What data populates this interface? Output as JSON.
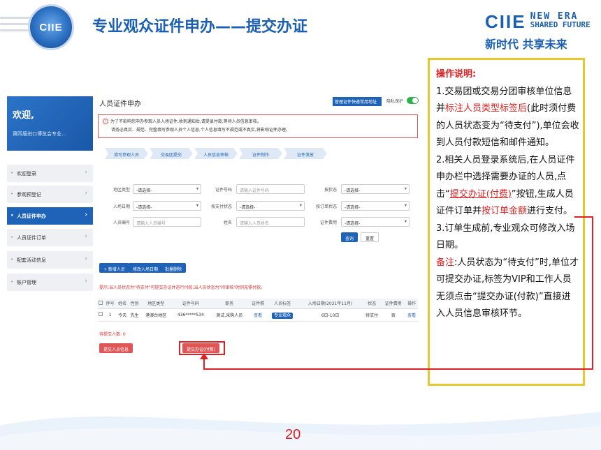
{
  "header": {
    "logo_text": "CIIE",
    "title": "专业观众证件申办——提交办证",
    "brand": "CIIE",
    "brand_line1": "NEW ERA",
    "brand_line2": "SHARED FUTURE",
    "slogan": "新时代 共享未来"
  },
  "sidebar": {
    "welcome": "欢迎,",
    "welcome_sub": "第四届进口博览会专业…",
    "items": [
      {
        "label": "欢迎登录"
      },
      {
        "label": "参观预登记"
      },
      {
        "label": "人员证件申办"
      },
      {
        "label": "人员证件订单"
      },
      {
        "label": "配套活动信息"
      },
      {
        "label": "账户管理"
      }
    ]
  },
  "main": {
    "title": "人员证件申办",
    "top_button": "管理证件快递常用地址",
    "privacy_label": "隐私保护",
    "notice_line1": "为了不影响您申办参观人员入场证件,收到通知后,请提录付款,等待人员信息审核。",
    "notice_line2": "请务必真实、规范、完整填写参观人员个人信息,个人信息填写不规范或不真实,将影响证件办理。",
    "steps": [
      "填写参观人员",
      "交易团提交",
      "人员信息审核",
      "证件制作",
      "证件发放"
    ],
    "filters": {
      "region_type": {
        "label": "地区类型",
        "value": "-请选择-"
      },
      "cert_no": {
        "label": "证件号码",
        "placeholder": "请输入证件号码"
      },
      "status": {
        "label": "按状态",
        "value": "-请选择-"
      },
      "entry_date": {
        "label": "入场日期",
        "value": "-请选择-"
      },
      "pay_status": {
        "label": "按支付状态",
        "value": "-请选择-"
      },
      "order_status": {
        "label": "按订单状态",
        "value": "-请选择-"
      },
      "person_no": {
        "label": "人员编号",
        "placeholder": "请输入人员编号"
      },
      "name": {
        "label": "姓名",
        "placeholder": "请输入人员姓名"
      },
      "cert_fee": {
        "label": "证件费用",
        "value": "-请选择-"
      }
    },
    "query_button": "查询",
    "reset_button": "重置",
    "action_buttons": [
      "+ 新增人员",
      "修改入场日期",
      "批量删除"
    ],
    "tip": "提示:当人员状态为\"待支付\"可提交办证并进行付款;当人员状态为\"待审核\"时则无需付款。",
    "table": {
      "headers": [
        "",
        "序号",
        "姓名",
        "性别",
        "地区类型",
        "证件号码",
        "职务",
        "证件照",
        "人员标签",
        "入场日期(2021年11月)",
        "状态",
        "证件费用",
        "操作"
      ],
      "rows": [
        [
          "",
          "1",
          "今天",
          "先生",
          "港澳台地区",
          "436*****534",
          "测试,采购人员",
          "查看",
          "专业观众",
          "6日-10日",
          "待支付",
          "否",
          "查看"
        ]
      ]
    },
    "pending_count": "待提交人数: 0",
    "submit_info_button": "提交人员信息",
    "submit_pay_button": "提交办证(付费)"
  },
  "panel": {
    "heading": "操作说明:",
    "p1_a": "1.交易团或交易分团审核单位信息并",
    "p1_red": "标注人员类型标签后",
    "p1_b": "(此时须付费的人员状态变为“待支付”),单位会收到人员付款短信和邮件通知。",
    "p2_a": "2.相关人员登录系统后,在人员证件申办栏中选择需要办证的人员,点击“",
    "p2_red": "提交办证(付费)",
    "p2_b": "”按钮,生成人员证件订单并",
    "p2_red2": "按订单金额",
    "p2_c": "进行支付。",
    "p3": "3.订单生成前,专业观众可修改入场日期。",
    "note_label": "备注",
    "note_text": ":人员状态为“待支付”时,单位才可提交办证,标签为VIP和工作人员无须点击“提交办证(付款)”直接进入人员信息审核环节。"
  },
  "page_number": "20",
  "colors": {
    "accent_blue": "#1e63b8",
    "highlight_red": "#e02020",
    "panel_border": "#e8c72c"
  }
}
